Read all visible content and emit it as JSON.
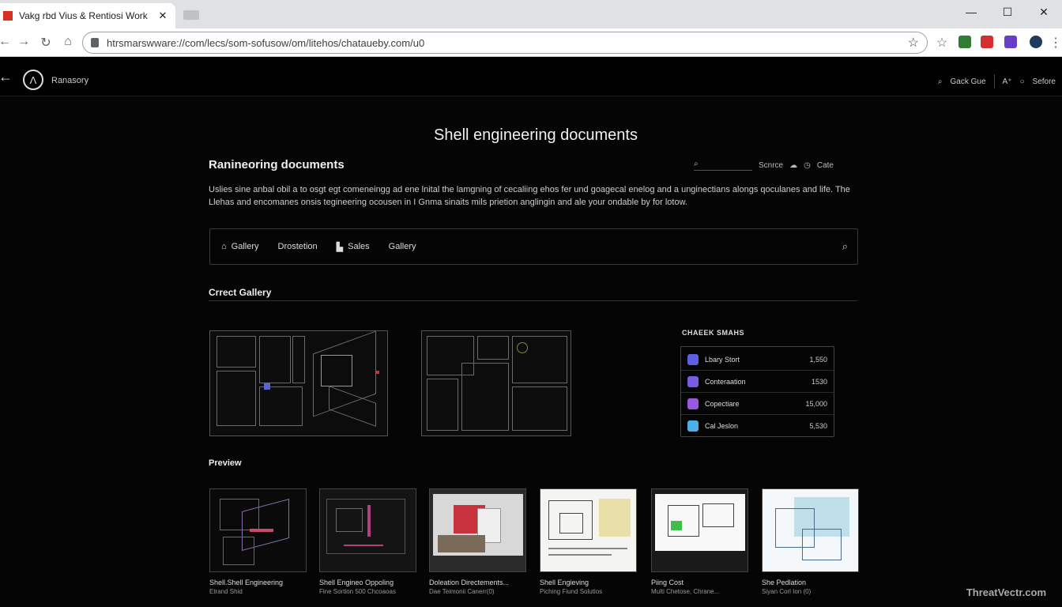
{
  "browser": {
    "tab_title": "Vakg rbd Vius & Rentiosi Work",
    "tab_close": "✕",
    "url": "htrsmarswware://com/lecs/som-sofusow/om/litehos/chataueby.com/u0",
    "window_min": "—",
    "window_max": "☐",
    "window_close": "✕",
    "bookmark_star": "☆"
  },
  "header": {
    "brand": "Ranasory",
    "search_label": "Gack Gue",
    "select_label": "Sefore"
  },
  "main": {
    "page_title": "Shell engineering documents",
    "section_title": "Ranineoring documents",
    "search_placeholder": "",
    "action_source": "Scnrce",
    "action_cafe": "Cate",
    "description": "Uslies sine anbal obil a to osgt egt comeneingg ad ene lnital the lamgning of cecaliing ehos fer und goagecal enelog and a unginectians alongs qoculanes and life. The Llehas and encomanes onsis tegineering ocousen in I Gnma sinaits mils prietion anglingin and ale your ondable by for lotow."
  },
  "filters": [
    {
      "label": "Gallery",
      "icon": "home-icon"
    },
    {
      "label": "Drostetion",
      "icon": ""
    },
    {
      "label": "Sales",
      "icon": "building-icon"
    },
    {
      "label": "Gallery",
      "icon": ""
    }
  ],
  "gallery": {
    "title": "Crrect Gallery"
  },
  "stats": {
    "title": "CHAEEK SMAHS",
    "rows": [
      {
        "label": "Lbary Stort",
        "value": "1,550",
        "color": "#5b5fe0"
      },
      {
        "label": "Conteraation",
        "value": "1530",
        "color": "#7b5ce0"
      },
      {
        "label": "Copectiare",
        "value": "15,000",
        "color": "#9a58e0"
      },
      {
        "label": "Cal Jeslon",
        "value": "5,530",
        "color": "#4ab0e8"
      }
    ]
  },
  "preview": {
    "title": "Preview",
    "cards": [
      {
        "title": "Shell.Shell Engineering",
        "sub": "Etrand Shid"
      },
      {
        "title": "Shell Engineo Oppoling",
        "sub": "Fine Sortion 500 Chcoaoas"
      },
      {
        "title": "Doleation Directements...",
        "sub": "Dae Teimonii Canerr(0)"
      },
      {
        "title": "Shell Engieving",
        "sub": "Piching Fiund Solutios"
      },
      {
        "title": "Piing Cost",
        "sub": "Multi Chetose, Chrane..."
      },
      {
        "title": "She Pedlation",
        "sub": "Siyan Corl Ion (0)"
      }
    ]
  },
  "watermark": "ThreatVectr.com"
}
